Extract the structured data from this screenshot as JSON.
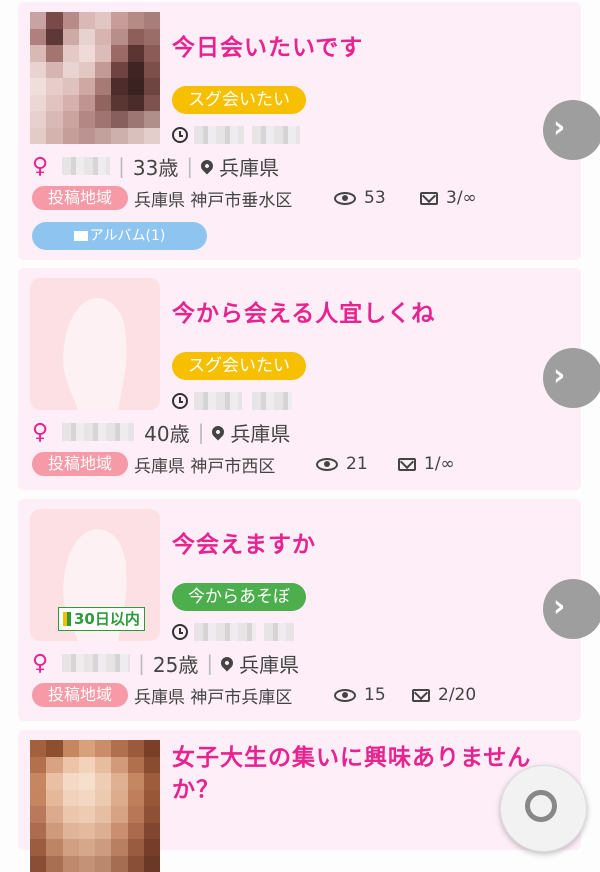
{
  "posts": [
    {
      "title": "今日会いたいです",
      "badge": "スグ会いたい",
      "age": "33歳",
      "prefecture": "兵庫県",
      "area_label": "投稿地域",
      "area": "兵庫県 神戸市垂水区",
      "views": "53",
      "mails": "3/∞",
      "album": "アルバム(1)"
    },
    {
      "title": "今から会える人宜しくね",
      "badge": "スグ会いたい",
      "age": "40歳",
      "prefecture": "兵庫県",
      "area_label": "投稿地域",
      "area": "兵庫県 神戸市西区",
      "views": "21",
      "mails": "1/∞"
    },
    {
      "title": "今会えますか",
      "badge": "今からあそぼ",
      "beginner_label": "30日以内",
      "age": "25歳",
      "prefecture": "兵庫県",
      "area_label": "投稿地域",
      "area": "兵庫県 神戸市兵庫区",
      "views": "15",
      "mails": "2/20"
    },
    {
      "title": "女子大生の集いに興味ありませんか？"
    }
  ],
  "gender_symbol": "♀",
  "arrow_glyph": "›",
  "colors": {
    "accent": "#e8228f",
    "card_bg": "#fdeef7",
    "badge_yellow": "#f6c000",
    "badge_green": "#4cae4c",
    "area_tag": "#f59aa6",
    "album": "#8ec5f0"
  }
}
